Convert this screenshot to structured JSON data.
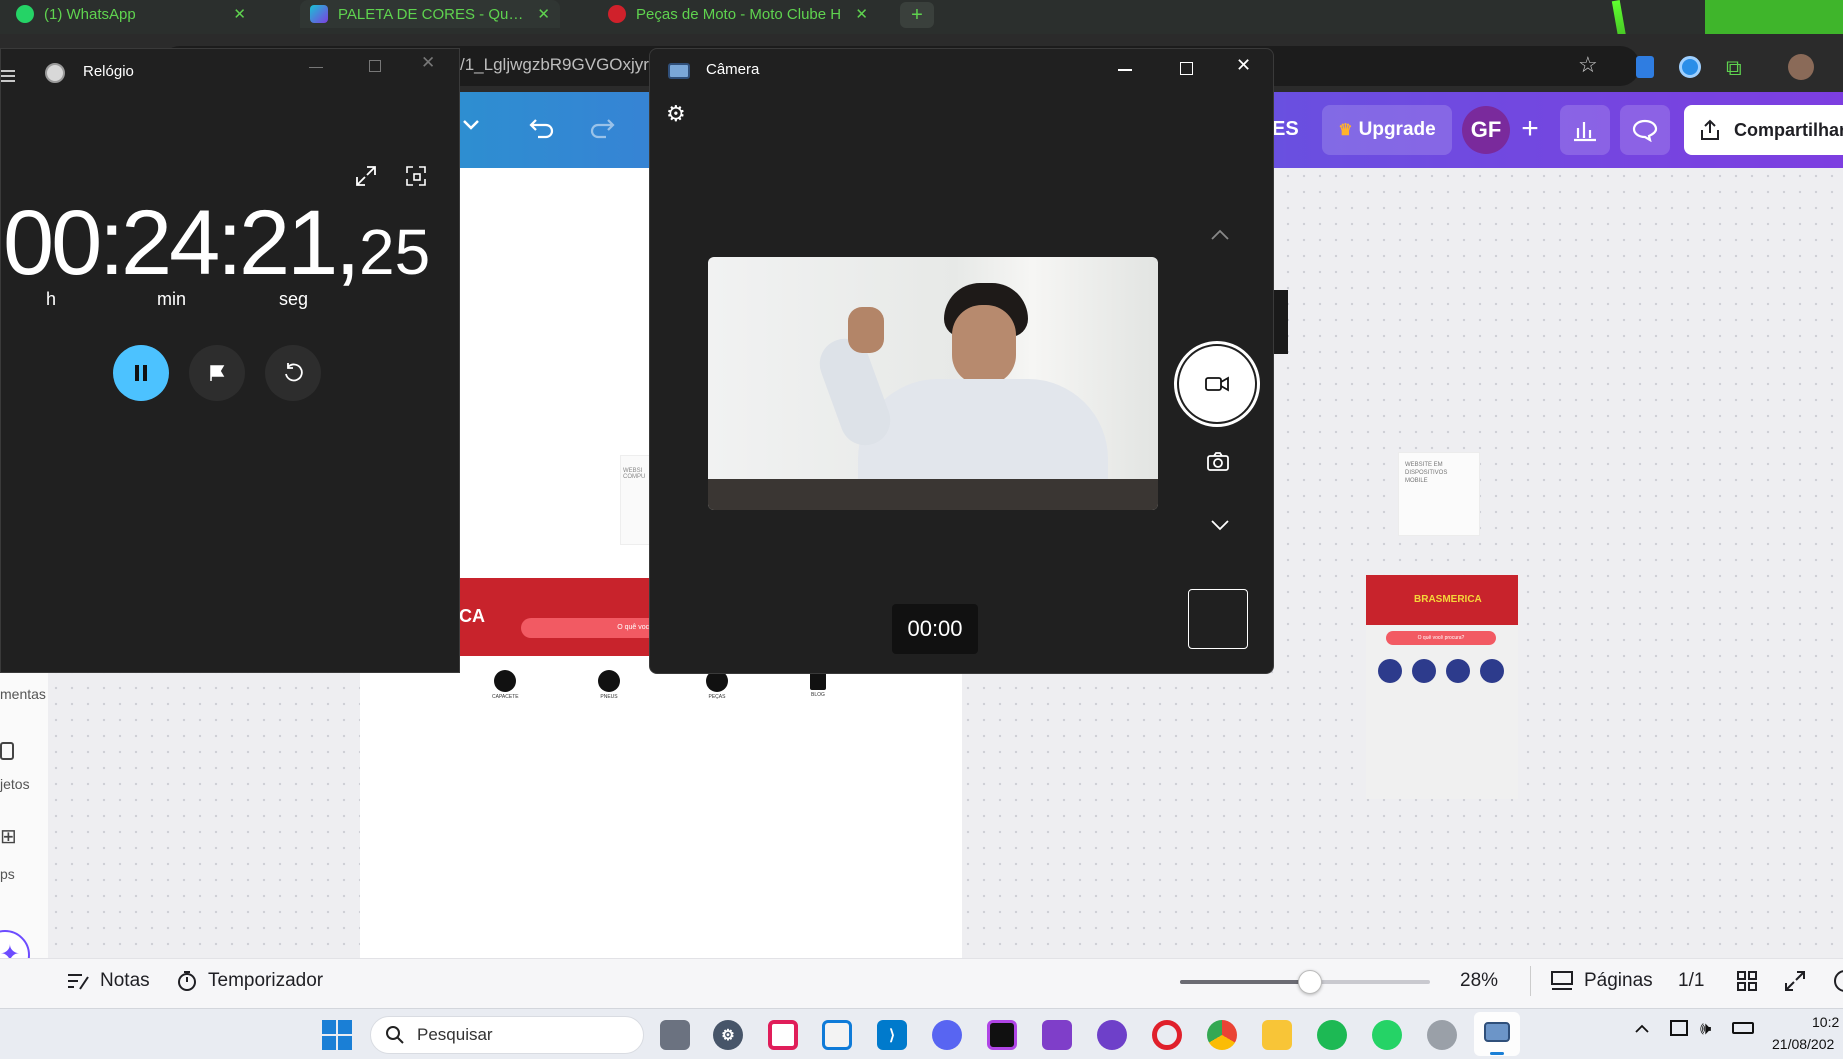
{
  "browser": {
    "tabs": [
      {
        "label": "(1) WhatsApp"
      },
      {
        "label": "PALETA DE CORES - Quadro bra"
      },
      {
        "label": "Peças de Moto - Moto Clube H"
      }
    ],
    "url_fragment": "/1_LgljwgzbR9GVGOxjyr"
  },
  "canva": {
    "upgrade_label": "Upgrade",
    "avatar_initials": "GF",
    "share_label": "Compartilhar",
    "partial_label": "ES",
    "sidebar_partial": [
      "mentas",
      "jetos",
      "ps"
    ],
    "bottom": {
      "notes_label": "Notas",
      "timer_label": "Temporizador",
      "zoom": "28%",
      "pages_label": "Páginas",
      "page_count": "1/1"
    },
    "mobile_preview": {
      "heading": "WEBSITE EM DISPOSITIVOS MOBILE",
      "brand": "BRASMERICA",
      "search_placeholder": "O quê você procura?"
    },
    "desktop_preview": {
      "heading_partial": "WEBSI COMPU",
      "brand_partial": "CA",
      "search_placeholder": "O quê você",
      "icons": [
        "CAPACETE",
        "PNEUS",
        "PEÇAS",
        "BLOG"
      ]
    }
  },
  "clock_app": {
    "title": "Relógio",
    "hours": "00",
    "minutes": "24",
    "seconds": "21",
    "hundredths": "25",
    "unit_h": "h",
    "unit_min": "min",
    "unit_seg": "seg"
  },
  "camera_app": {
    "title": "Câmera",
    "timer": "00:00"
  },
  "taskbar": {
    "search_placeholder": "Pesquisar",
    "time": "10:2",
    "date": "21/08/202"
  },
  "colors": {
    "tab_text": "#5fd34f",
    "clock_accent": "#4cc2ff",
    "canva_gradient_start": "#19a7c8",
    "canva_gradient_end": "#7d3ee0",
    "brand_red": "#c8232c"
  }
}
